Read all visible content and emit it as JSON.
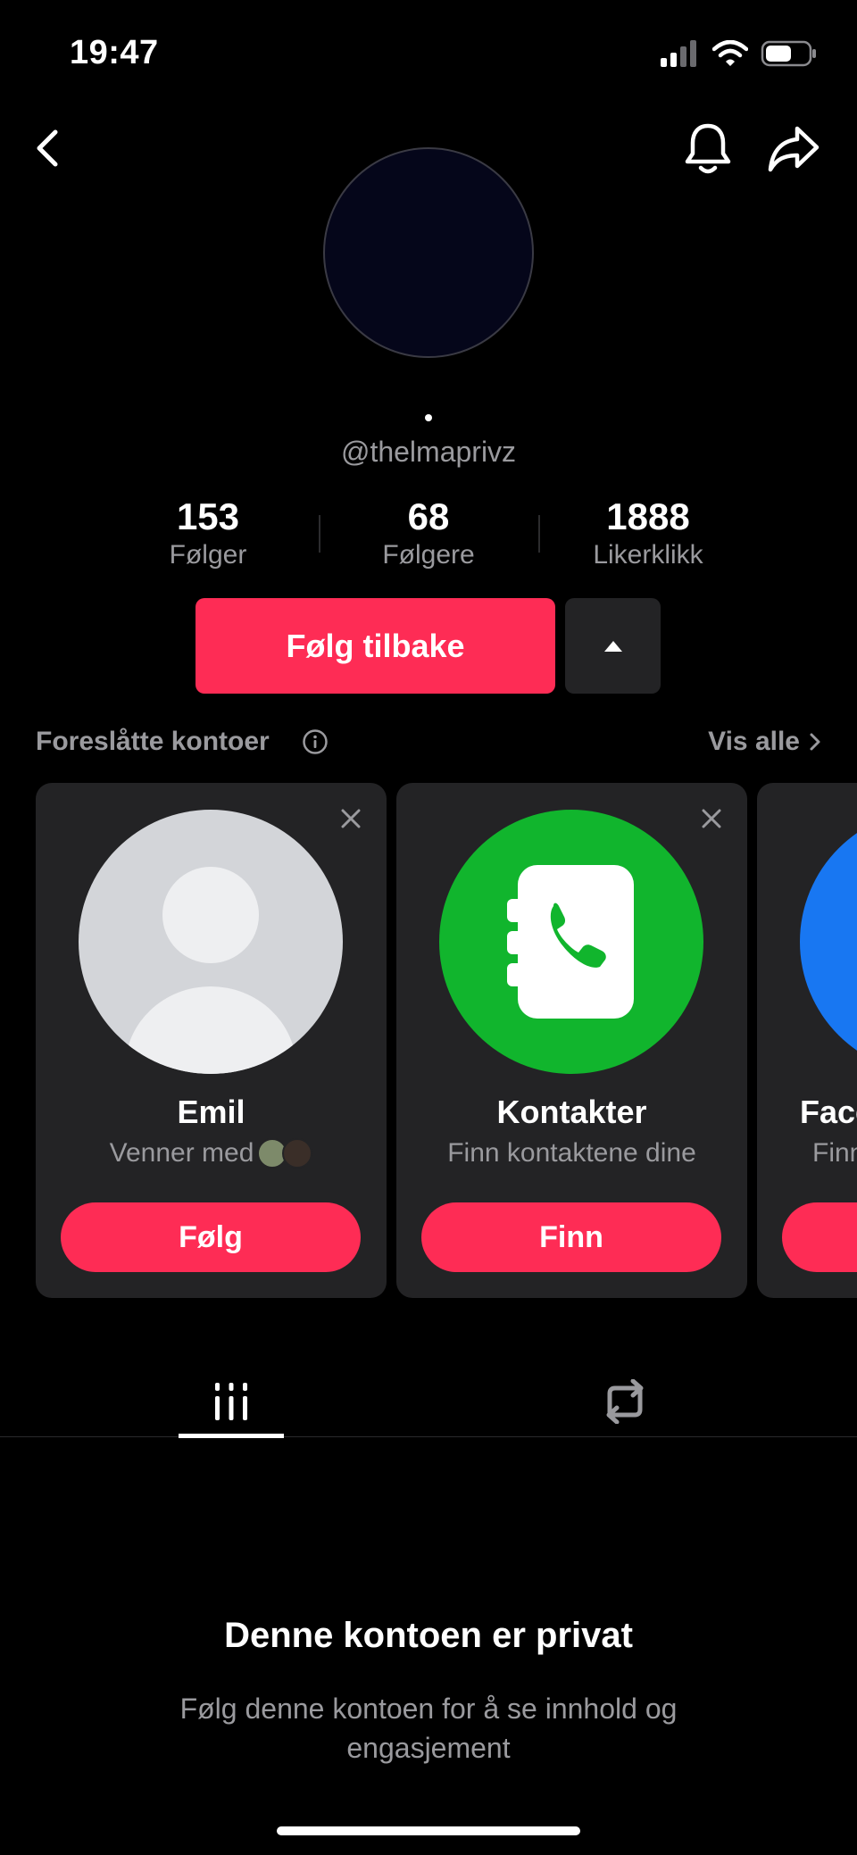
{
  "status_bar": {
    "time": "19:47",
    "battery_level": 0.6
  },
  "nav": {
    "back_icon": "chevron-left-icon",
    "bell_icon": "bell-icon",
    "share_icon": "share-icon"
  },
  "profile": {
    "username": "@thelmaprivz",
    "stats": [
      {
        "value": "153",
        "label": "Følger"
      },
      {
        "value": "68",
        "label": "Følgere"
      },
      {
        "value": "1888",
        "label": "Likerklikk"
      }
    ],
    "follow_back_label": "Følg tilbake"
  },
  "suggestions": {
    "title": "Foreslåtte kontoer",
    "see_all_label": "Vis alle",
    "cards": [
      {
        "name": "Emil",
        "subtitle": "Venner med",
        "button": "Følg"
      },
      {
        "name": "Kontakter",
        "subtitle": "Finn kontaktene dine",
        "button": "Finn"
      },
      {
        "name": "Face",
        "subtitle": "Finn",
        "button": ""
      }
    ]
  },
  "colors": {
    "accent": "#fe2c55",
    "card_bg": "#232325",
    "contacts_green": "#11b52d",
    "facebook_blue": "#1877f2"
  },
  "private": {
    "title": "Denne kontoen er privat",
    "subtitle": "Følg denne kontoen for å se innhold og engasjement"
  }
}
